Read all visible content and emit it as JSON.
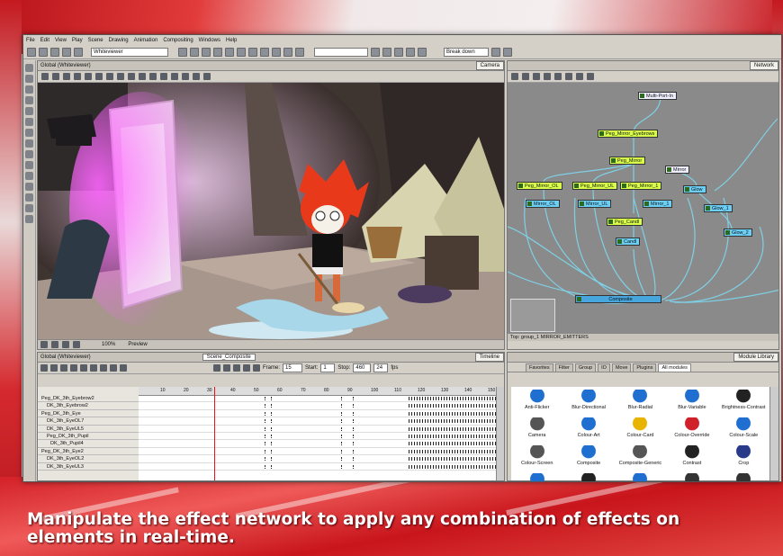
{
  "caption": "Manipulate the effect network to apply any combination of effects on elements in real-time.",
  "menu": [
    "File",
    "Edit",
    "View",
    "Play",
    "Scene",
    "Drawing",
    "Animation",
    "Compositing",
    "Windows",
    "Help"
  ],
  "toolbar": {
    "dropdown1": "Whiteviewer",
    "dropdown2": "Break down"
  },
  "camera": {
    "title": "Global (Whiteviewer)",
    "tab": "Camera",
    "zoom": "100%",
    "mode": "Preview"
  },
  "network": {
    "tab": "Network",
    "nodes": [
      {
        "label": "Multi-Port-In",
        "kind": "white"
      },
      {
        "label": "Peg_Mirror_Eyebrows",
        "kind": "green"
      },
      {
        "label": "Peg_Mirror",
        "kind": "green"
      },
      {
        "label": "Mirror",
        "kind": "blue"
      },
      {
        "label": "Peg_Mirror_OL",
        "kind": "green"
      },
      {
        "label": "Peg_Mirror_UL",
        "kind": "green"
      },
      {
        "label": "Peg_Mirror_1",
        "kind": "green"
      },
      {
        "label": "Mirror_OL",
        "kind": "blue"
      },
      {
        "label": "Mirror_UL",
        "kind": "blue"
      },
      {
        "label": "Mirror_1",
        "kind": "blue"
      },
      {
        "label": "Glow",
        "kind": "blue"
      },
      {
        "label": "Glow_1",
        "kind": "blue"
      },
      {
        "label": "Peg_Candl",
        "kind": "green"
      },
      {
        "label": "Candl",
        "kind": "blue"
      },
      {
        "label": "Glow_2",
        "kind": "blue"
      },
      {
        "label": "Composite",
        "kind": "comp"
      }
    ],
    "footer": "Top: group_1 MIRROR_EMITTERS"
  },
  "timeline": {
    "title": "Global (Whiteviewer)",
    "scene": "Scene_Composite",
    "tab": "Timeline",
    "frame_label": "Frame:",
    "frame": "15",
    "start_label": "Start:",
    "start": "1",
    "stop_label": "Stop:",
    "stop": "460",
    "fps_label": "fps",
    "fps": "24",
    "rows": [
      "Peg_DK_3th_Eyebrow2",
      "DK_3th_Eyebrow2",
      "Peg_DK_3th_Eye",
      "DK_3th_EyeOL7",
      "DK_3th_EyeUL5",
      "Peg_DK_3th_Pupil",
      "DK_3th_Pupil4",
      "Peg_DK_3th_Eye2",
      "DK_3th_EyeOL2",
      "DK_3th_EyeUL3"
    ],
    "ruler": [
      "10",
      "20",
      "30",
      "40",
      "50",
      "60",
      "70",
      "80",
      "90",
      "100",
      "110",
      "120",
      "130",
      "140",
      "150"
    ]
  },
  "library": {
    "title": "Module Library",
    "tabs": [
      "Favorites",
      "Filter",
      "Group",
      "IO",
      "Move",
      "Plugins",
      "All modules"
    ],
    "items": [
      {
        "label": "Anti-Flicker",
        "color": "#1e6fd0"
      },
      {
        "label": "Blur-Directional",
        "color": "#1e6fd0"
      },
      {
        "label": "Blur-Radial",
        "color": "#1e6fd0"
      },
      {
        "label": "Blur-Variable",
        "color": "#1e6fd0"
      },
      {
        "label": "Brightness-Contrast",
        "color": "#222222"
      },
      {
        "label": "Camera",
        "color": "#555555"
      },
      {
        "label": "Colour-Art",
        "color": "#1e6fd0"
      },
      {
        "label": "Colour-Card",
        "color": "#e8b400"
      },
      {
        "label": "Colour-Override",
        "color": "#d0202a"
      },
      {
        "label": "Colour-Scale",
        "color": "#1e6fd0"
      },
      {
        "label": "Colour-Screen",
        "color": "#555555"
      },
      {
        "label": "Composite",
        "color": "#1e6fd0"
      },
      {
        "label": "Composite-Generic",
        "color": "#555555"
      },
      {
        "label": "Contrast",
        "color": "#222222"
      },
      {
        "label": "Crop",
        "color": "#2a3a8a"
      },
      {
        "label": "Cutter",
        "color": "#1e6fd0"
      },
      {
        "label": "Display",
        "color": "#222222"
      },
      {
        "label": "Glow",
        "color": "#1e6fd0"
      },
      {
        "label": "Element",
        "color": "#333333"
      },
      {
        "label": "External",
        "color": "#333333"
      }
    ]
  }
}
